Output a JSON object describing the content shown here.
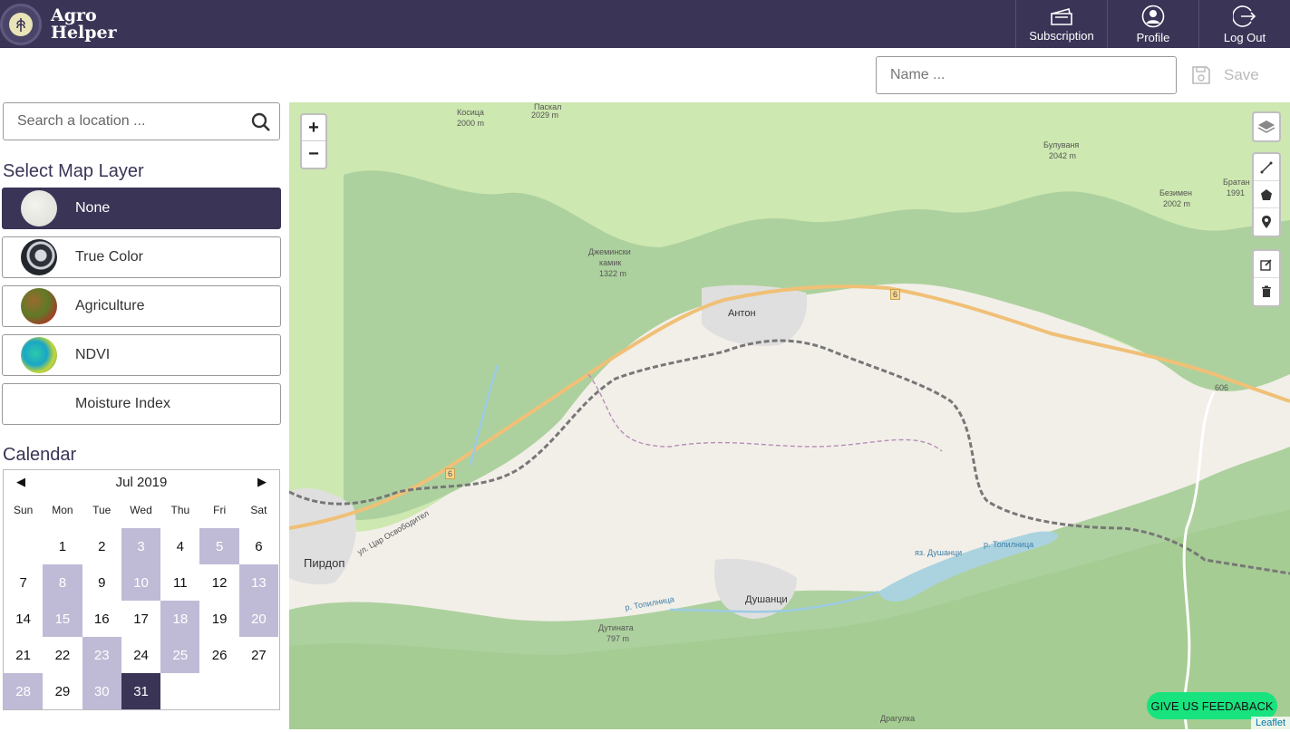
{
  "header": {
    "brand_line1": "Agro",
    "brand_line2": "Helper",
    "nav": [
      {
        "label": "Subscription",
        "icon": "wallet-icon"
      },
      {
        "label": "Profile",
        "icon": "user-icon"
      },
      {
        "label": "Log Out",
        "icon": "logout-icon"
      }
    ]
  },
  "toolbar": {
    "name_placeholder": "Name ...",
    "save_label": "Save"
  },
  "search": {
    "placeholder": "Search a location ..."
  },
  "layers": {
    "title": "Select Map Layer",
    "items": [
      {
        "label": "None",
        "active": true
      },
      {
        "label": "True Color",
        "active": false
      },
      {
        "label": "Agriculture",
        "active": false
      },
      {
        "label": "NDVI",
        "active": false
      },
      {
        "label": "Moisture Index",
        "active": false
      }
    ]
  },
  "calendar": {
    "title": "Calendar",
    "month": "Jul 2019",
    "prev": "◀",
    "next": "▶",
    "dow": [
      "Sun",
      "Mon",
      "Tue",
      "Wed",
      "Thu",
      "Fri",
      "Sat"
    ],
    "start_offset": 1,
    "days": 31,
    "available_days": [
      3,
      5,
      8,
      10,
      13,
      15,
      18,
      20,
      23,
      25,
      28,
      30
    ],
    "selected_day": 31
  },
  "map": {
    "zoom_in": "+",
    "zoom_out": "−",
    "feedback_label": "GIVE US FEEDABACK",
    "attribution": "Leaflet",
    "labels": {
      "anton": "Антон",
      "pirdop": "Пирдоп",
      "dushantsi": "Душанци",
      "kositsa": "Косица",
      "kositsa_elev": "2000 m",
      "paskal": "Паскал",
      "paskal_elev": "2029 m",
      "bulu": "Булуваня",
      "bulu_elev": "2042 m",
      "bezimen": "Безимен",
      "bezimen_elev": "2002 m",
      "bratan": "Братан",
      "bratan_elev": "1991",
      "dzhem1": "Джемински",
      "dzhem2": "камик",
      "dzhem_elev": "1322 m",
      "dutinata": "Дутината",
      "dutinata_elev": "797 m",
      "dragulka": "Драгулка",
      "road6": "6",
      "road606": "606",
      "toplica": "р. Топилница",
      "yaz": "яз. Душанци",
      "car_osv": "ул. Цар Освободител",
      "toplica2": "р. Топилница"
    }
  },
  "colors": {
    "brand": "#3a3456",
    "calendar_available": "#bfbbd6",
    "feedback": "#19e37f"
  }
}
